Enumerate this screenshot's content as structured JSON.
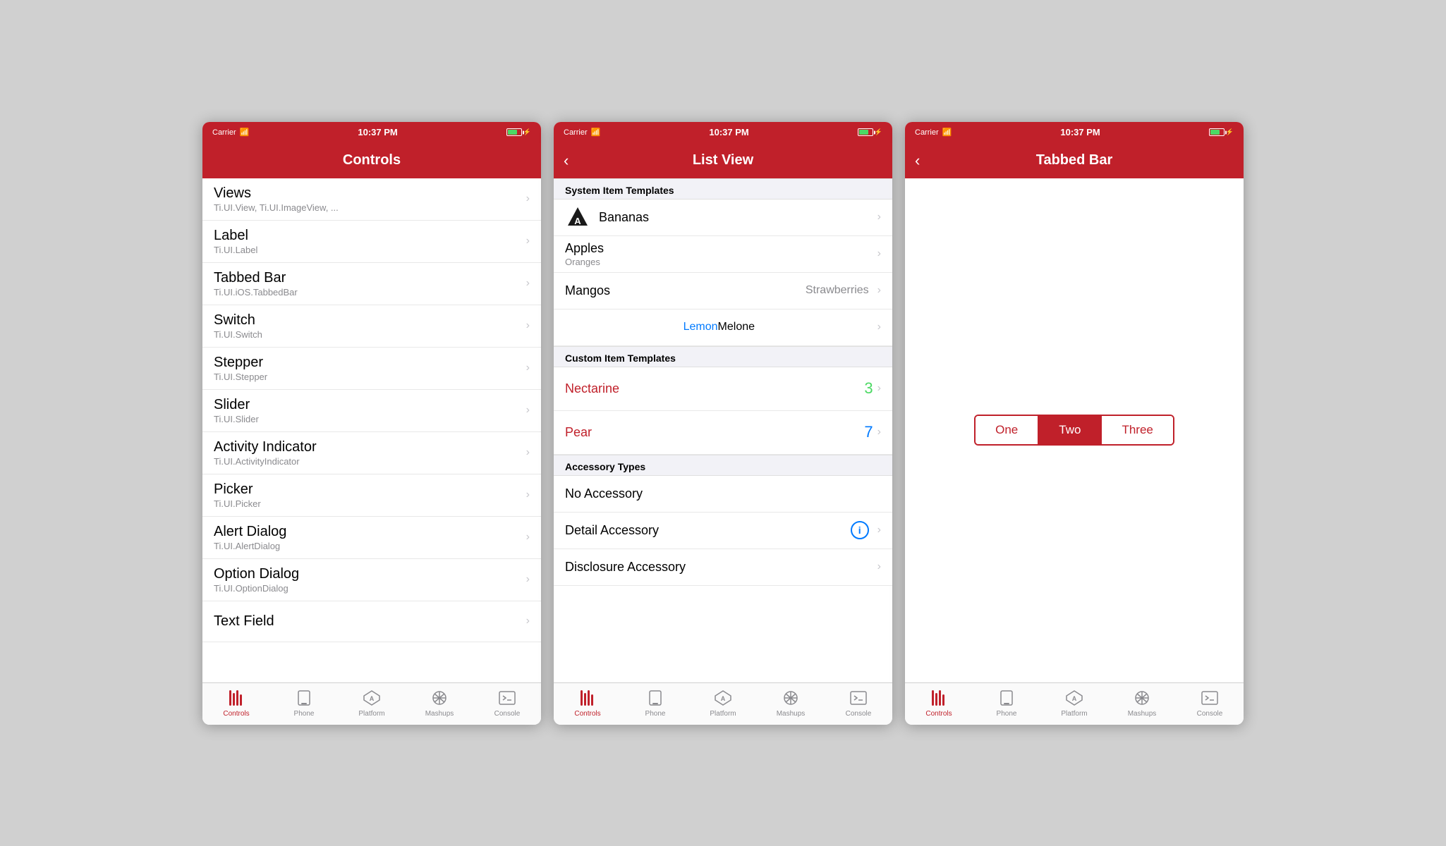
{
  "screens": [
    {
      "id": "controls",
      "statusBar": {
        "carrier": "Carrier",
        "time": "10:37 PM"
      },
      "navBar": {
        "title": "Controls",
        "hasBack": false
      },
      "listItems": [
        {
          "title": "Views",
          "subtitle": "Ti.UI.View, Ti.UI.ImageView, ..."
        },
        {
          "title": "Label",
          "subtitle": "Ti.UI.Label"
        },
        {
          "title": "Tabbed Bar",
          "subtitle": "Ti.UI.iOS.TabbedBar"
        },
        {
          "title": "Switch",
          "subtitle": "Ti.UI.Switch"
        },
        {
          "title": "Stepper",
          "subtitle": "Ti.UI.Stepper"
        },
        {
          "title": "Slider",
          "subtitle": "Ti.UI.Slider"
        },
        {
          "title": "Activity Indicator",
          "subtitle": "Ti.UI.ActivityIndicator"
        },
        {
          "title": "Picker",
          "subtitle": "Ti.UI.Picker"
        },
        {
          "title": "Alert Dialog",
          "subtitle": "Ti.UI.AlertDialog"
        },
        {
          "title": "Option Dialog",
          "subtitle": "Ti.UI.OptionDialog"
        },
        {
          "title": "Text Field",
          "subtitle": ""
        }
      ],
      "tabBar": {
        "items": [
          {
            "label": "Controls",
            "active": true
          },
          {
            "label": "Phone",
            "active": false
          },
          {
            "label": "Platform",
            "active": false
          },
          {
            "label": "Mashups",
            "active": false
          },
          {
            "label": "Console",
            "active": false
          }
        ]
      }
    },
    {
      "id": "listview",
      "statusBar": {
        "carrier": "Carrier",
        "time": "10:37 PM"
      },
      "navBar": {
        "title": "List View",
        "hasBack": true
      },
      "sections": [
        {
          "header": "System Item Templates",
          "rows": [
            {
              "type": "system",
              "title": "Bananas",
              "hasIcon": true
            },
            {
              "type": "system",
              "title": "Apples",
              "subtitle": "Oranges"
            },
            {
              "type": "system",
              "title": "Mangos",
              "value": "Strawberries"
            },
            {
              "type": "system",
              "lemon": "Lemon",
              "melone": " Melone"
            }
          ]
        },
        {
          "header": "Custom Item Templates",
          "rows": [
            {
              "type": "custom",
              "title": "Nectarine",
              "badge": "3",
              "badgeColor": "green"
            },
            {
              "type": "custom",
              "title": "Pear",
              "badge": "7",
              "badgeColor": "blue"
            }
          ]
        },
        {
          "header": "Accessory Types",
          "rows": [
            {
              "type": "accessory",
              "title": "No Accessory"
            },
            {
              "type": "accessory-detail",
              "title": "Detail Accessory"
            },
            {
              "type": "accessory-disclosure",
              "title": "Disclosure Accessory"
            }
          ]
        }
      ],
      "tabBar": {
        "items": [
          {
            "label": "Controls",
            "active": true
          },
          {
            "label": "Phone",
            "active": false
          },
          {
            "label": "Platform",
            "active": false
          },
          {
            "label": "Mashups",
            "active": false
          },
          {
            "label": "Console",
            "active": false
          }
        ]
      }
    },
    {
      "id": "tabbedbar",
      "statusBar": {
        "carrier": "Carrier",
        "time": "10:37 PM"
      },
      "navBar": {
        "title": "Tabbed Bar",
        "hasBack": true
      },
      "segmented": {
        "buttons": [
          {
            "label": "One",
            "active": false
          },
          {
            "label": "Two",
            "active": true
          },
          {
            "label": "Three",
            "active": false
          }
        ]
      },
      "tabBar": {
        "items": [
          {
            "label": "Controls",
            "active": true
          },
          {
            "label": "Phone",
            "active": false
          },
          {
            "label": "Platform",
            "active": false
          },
          {
            "label": "Mashups",
            "active": false
          },
          {
            "label": "Console",
            "active": false
          }
        ]
      }
    }
  ]
}
